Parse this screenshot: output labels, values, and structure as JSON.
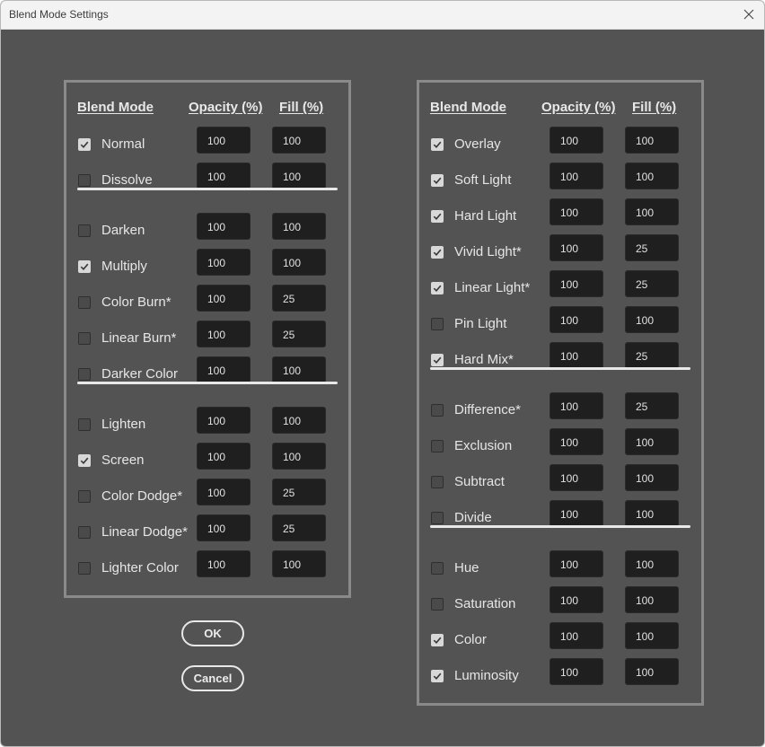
{
  "window": {
    "title": "Blend Mode Settings",
    "close_icon": "close-icon"
  },
  "headers": {
    "mode": "Blend Mode",
    "opacity": "Opacity (%)",
    "fill": "Fill (%)"
  },
  "left_panel": {
    "groups": [
      [
        {
          "label": "Normal",
          "checked": true,
          "opacity": "100",
          "fill": "100"
        },
        {
          "label": "Dissolve",
          "checked": false,
          "opacity": "100",
          "fill": "100"
        }
      ],
      [
        {
          "label": "Darken",
          "checked": false,
          "opacity": "100",
          "fill": "100"
        },
        {
          "label": "Multiply",
          "checked": true,
          "opacity": "100",
          "fill": "100"
        },
        {
          "label": "Color Burn*",
          "checked": false,
          "opacity": "100",
          "fill": "25"
        },
        {
          "label": "Linear Burn*",
          "checked": false,
          "opacity": "100",
          "fill": "25"
        },
        {
          "label": "Darker Color",
          "checked": false,
          "opacity": "100",
          "fill": "100"
        }
      ],
      [
        {
          "label": "Lighten",
          "checked": false,
          "opacity": "100",
          "fill": "100"
        },
        {
          "label": "Screen",
          "checked": true,
          "opacity": "100",
          "fill": "100"
        },
        {
          "label": "Color Dodge*",
          "checked": false,
          "opacity": "100",
          "fill": "25"
        },
        {
          "label": "Linear Dodge*",
          "checked": false,
          "opacity": "100",
          "fill": "25"
        },
        {
          "label": "Lighter Color",
          "checked": false,
          "opacity": "100",
          "fill": "100"
        }
      ]
    ]
  },
  "right_panel": {
    "groups": [
      [
        {
          "label": "Overlay",
          "checked": true,
          "opacity": "100",
          "fill": "100"
        },
        {
          "label": "Soft Light",
          "checked": true,
          "opacity": "100",
          "fill": "100"
        },
        {
          "label": "Hard Light",
          "checked": true,
          "opacity": "100",
          "fill": "100"
        },
        {
          "label": "Vivid Light*",
          "checked": true,
          "opacity": "100",
          "fill": "25"
        },
        {
          "label": "Linear Light*",
          "checked": true,
          "opacity": "100",
          "fill": "25"
        },
        {
          "label": "Pin Light",
          "checked": false,
          "opacity": "100",
          "fill": "100"
        },
        {
          "label": "Hard Mix*",
          "checked": true,
          "opacity": "100",
          "fill": "25"
        }
      ],
      [
        {
          "label": "Difference*",
          "checked": false,
          "opacity": "100",
          "fill": "25"
        },
        {
          "label": "Exclusion",
          "checked": false,
          "opacity": "100",
          "fill": "100"
        },
        {
          "label": "Subtract",
          "checked": false,
          "opacity": "100",
          "fill": "100"
        },
        {
          "label": "Divide",
          "checked": false,
          "opacity": "100",
          "fill": "100"
        }
      ],
      [
        {
          "label": "Hue",
          "checked": false,
          "opacity": "100",
          "fill": "100"
        },
        {
          "label": "Saturation",
          "checked": false,
          "opacity": "100",
          "fill": "100"
        },
        {
          "label": "Color",
          "checked": true,
          "opacity": "100",
          "fill": "100"
        },
        {
          "label": "Luminosity",
          "checked": true,
          "opacity": "100",
          "fill": "100"
        }
      ]
    ]
  },
  "buttons": {
    "ok": "OK",
    "cancel": "Cancel"
  }
}
